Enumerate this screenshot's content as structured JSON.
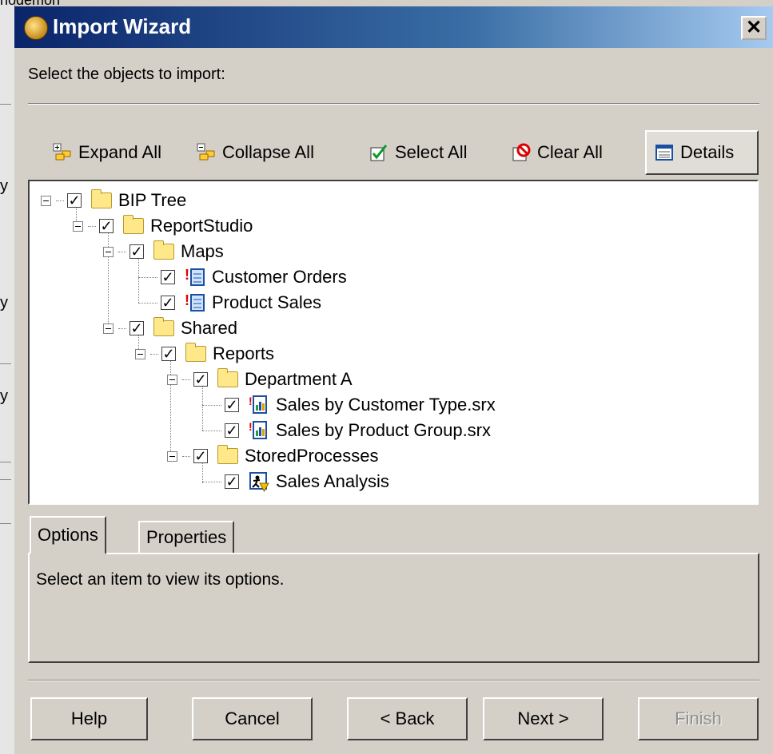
{
  "background": {
    "fragment_text": "nodemon",
    "left_glyphs": [
      "y",
      "y",
      "y"
    ]
  },
  "window": {
    "title": "Import Wizard",
    "close_symbol": "✕"
  },
  "instruction": "Select the objects to import:",
  "toolbar": {
    "expand_all": "Expand All",
    "collapse_all": "Collapse All",
    "select_all": "Select All",
    "clear_all": "Clear All",
    "details": "Details"
  },
  "tree": {
    "check_symbol": "✓",
    "nodes": [
      {
        "label": "BIP Tree",
        "icon": "folder-icon",
        "checked": true
      },
      {
        "label": "ReportStudio",
        "icon": "folder-icon",
        "checked": true
      },
      {
        "label": "Maps",
        "icon": "folder-icon",
        "checked": true
      },
      {
        "label": "Customer Orders",
        "icon": "map-icon",
        "checked": true
      },
      {
        "label": "Product Sales",
        "icon": "map-icon",
        "checked": true
      },
      {
        "label": "Shared",
        "icon": "folder-icon",
        "checked": true
      },
      {
        "label": "Reports",
        "icon": "folder-icon",
        "checked": true
      },
      {
        "label": "Department A",
        "icon": "folder-icon",
        "checked": true
      },
      {
        "label": "Sales by Customer Type.srx",
        "icon": "report-icon",
        "checked": true
      },
      {
        "label": "Sales by Product Group.srx",
        "icon": "report-icon",
        "checked": true
      },
      {
        "label": "StoredProcesses",
        "icon": "folder-icon",
        "checked": true
      },
      {
        "label": "Sales Analysis",
        "icon": "stored-process-icon",
        "checked": true
      }
    ]
  },
  "tabs": {
    "options": "Options",
    "properties": "Properties",
    "panel_text": "Select an item to view its options."
  },
  "buttons": {
    "help": "Help",
    "cancel": "Cancel",
    "back": "< Back",
    "next": "Next >",
    "finish": "Finish"
  },
  "colors": {
    "titlebar_start": "#0a246a",
    "titlebar_end": "#a6caf0",
    "dialog_bg": "#d4d0c8"
  }
}
